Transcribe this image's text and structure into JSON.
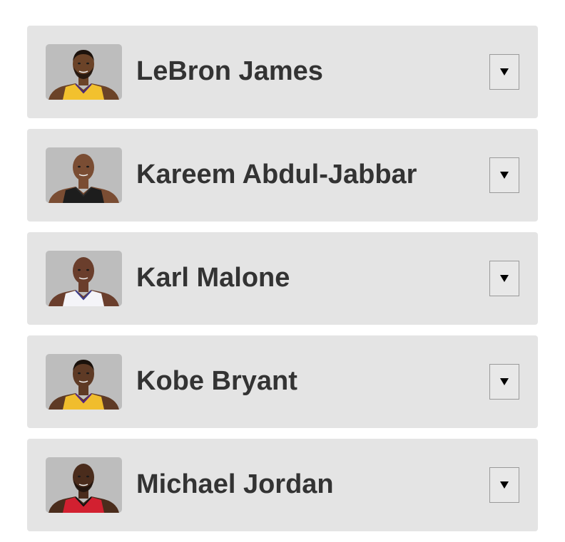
{
  "players": [
    {
      "name": "LeBron James",
      "skin": "#6b4328",
      "hair": "#1c120c",
      "beard": true,
      "jersey": "#f2c12e",
      "trim": "#4b2a7a",
      "bald": false
    },
    {
      "name": "Kareem Abdul-Jabbar",
      "skin": "#7a4d33",
      "hair": "#7a4d33",
      "beard": false,
      "jersey": "#1d1d1d",
      "trim": "#2a2a2a",
      "bald": true
    },
    {
      "name": "Karl Malone",
      "skin": "#6a3e2c",
      "hair": "#6a3e2c",
      "beard": false,
      "jersey": "#f4f4f8",
      "trim": "#3c3c8c",
      "bald": true
    },
    {
      "name": "Kobe Bryant",
      "skin": "#5e3a25",
      "hair": "#1a110b",
      "beard": false,
      "jersey": "#f0bd2d",
      "trim": "#552583",
      "bald": false
    },
    {
      "name": "Michael Jordan",
      "skin": "#4a2c1c",
      "hair": "#4a2c1c",
      "beard": true,
      "jersey": "#d22030",
      "trim": "#111111",
      "bald": true
    }
  ],
  "toggle_icon": "triangle-down-icon"
}
